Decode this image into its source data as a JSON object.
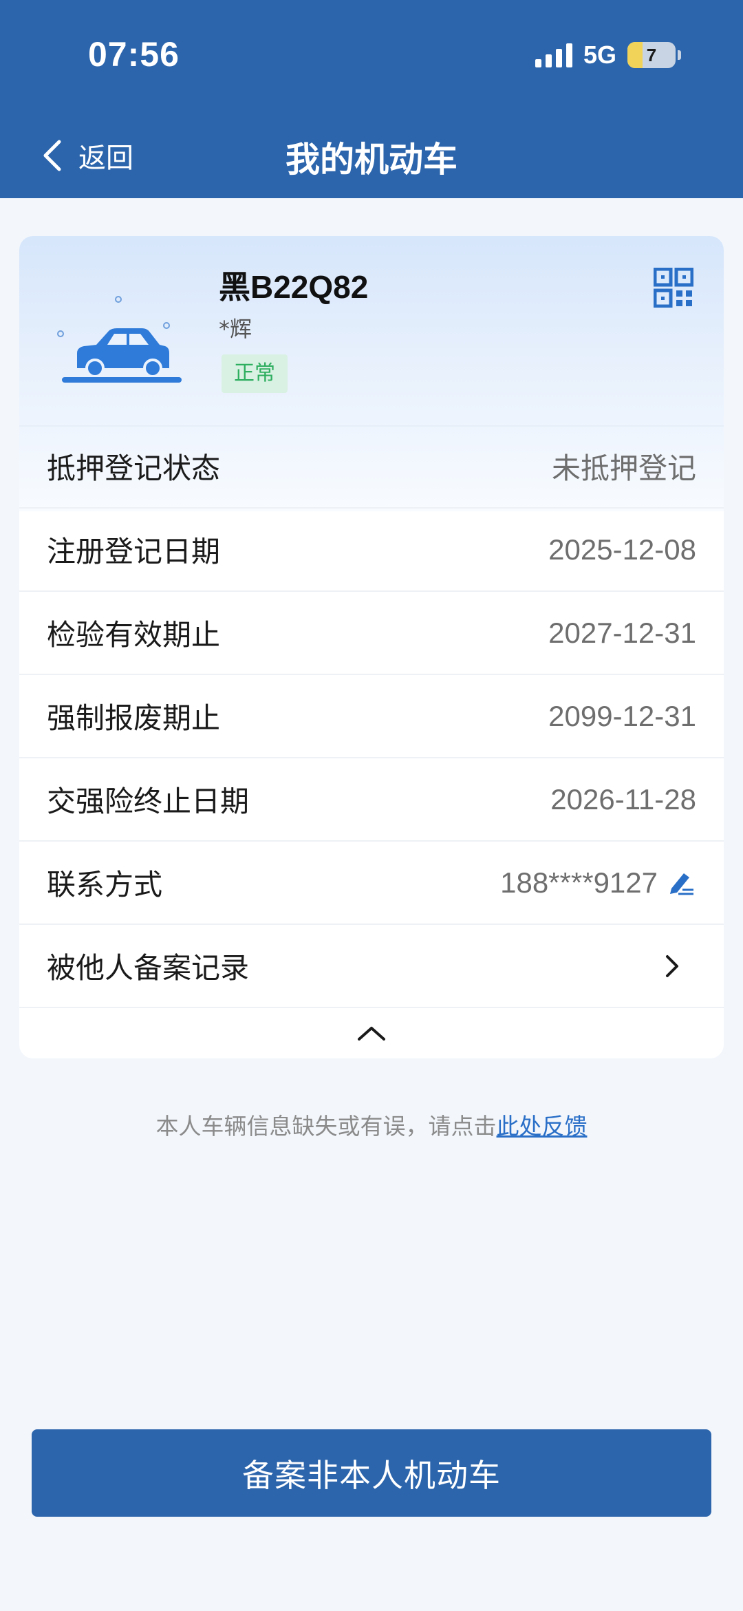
{
  "status_bar": {
    "time": "07:56",
    "network": "5G",
    "battery": "7"
  },
  "nav": {
    "back_label": "返回",
    "title": "我的机动车"
  },
  "vehicle": {
    "plate": "黑B22Q82",
    "owner": "*辉",
    "status": "正常",
    "status_color": "#2eae5f"
  },
  "details": [
    {
      "label": "抵押登记状态",
      "value": "未抵押登记"
    },
    {
      "label": "注册登记日期",
      "value": "2025-12-08"
    },
    {
      "label": "检验有效期止",
      "value": "2027-12-31"
    },
    {
      "label": "强制报废期止",
      "value": "2099-12-31"
    },
    {
      "label": "交强险终止日期",
      "value": "2026-11-28"
    },
    {
      "label": "联系方式",
      "value": "188****9127"
    },
    {
      "label": "被他人备案记录"
    }
  ],
  "feedback": {
    "text": "本人车辆信息缺失或有误，请点击",
    "link": "此处反馈"
  },
  "primary_button": {
    "label": "备案非本人机动车"
  },
  "colors": {
    "header": "#2c65ac",
    "accent": "#2a6fc7"
  },
  "icons": [
    "chevron-left-icon",
    "car-icon",
    "qr-code-icon",
    "edit-icon",
    "chevron-right-icon",
    "chevron-up-icon"
  ]
}
